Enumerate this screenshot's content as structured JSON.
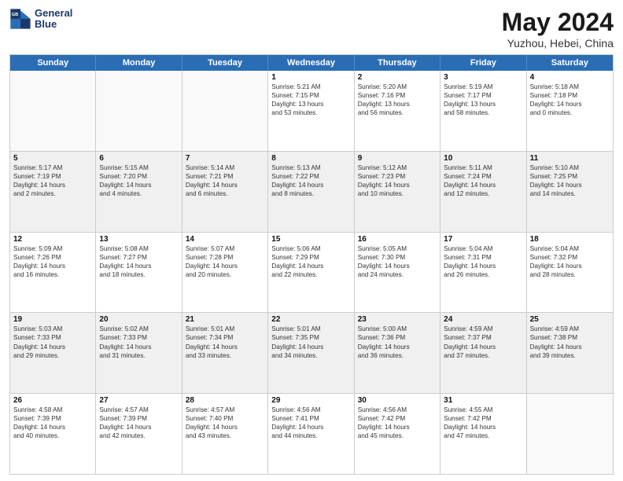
{
  "header": {
    "logo_line1": "General",
    "logo_line2": "Blue",
    "title": "May 2024",
    "location": "Yuzhou, Hebei, China"
  },
  "weekdays": [
    "Sunday",
    "Monday",
    "Tuesday",
    "Wednesday",
    "Thursday",
    "Friday",
    "Saturday"
  ],
  "rows": [
    [
      {
        "day": "",
        "info": [],
        "empty": true
      },
      {
        "day": "",
        "info": [],
        "empty": true
      },
      {
        "day": "",
        "info": [],
        "empty": true
      },
      {
        "day": "1",
        "info": [
          "Sunrise: 5:21 AM",
          "Sunset: 7:15 PM",
          "Daylight: 13 hours",
          "and 53 minutes."
        ]
      },
      {
        "day": "2",
        "info": [
          "Sunrise: 5:20 AM",
          "Sunset: 7:16 PM",
          "Daylight: 13 hours",
          "and 56 minutes."
        ]
      },
      {
        "day": "3",
        "info": [
          "Sunrise: 5:19 AM",
          "Sunset: 7:17 PM",
          "Daylight: 13 hours",
          "and 58 minutes."
        ]
      },
      {
        "day": "4",
        "info": [
          "Sunrise: 5:18 AM",
          "Sunset: 7:18 PM",
          "Daylight: 14 hours",
          "and 0 minutes."
        ]
      }
    ],
    [
      {
        "day": "5",
        "info": [
          "Sunrise: 5:17 AM",
          "Sunset: 7:19 PM",
          "Daylight: 14 hours",
          "and 2 minutes."
        ],
        "shaded": true
      },
      {
        "day": "6",
        "info": [
          "Sunrise: 5:15 AM",
          "Sunset: 7:20 PM",
          "Daylight: 14 hours",
          "and 4 minutes."
        ],
        "shaded": true
      },
      {
        "day": "7",
        "info": [
          "Sunrise: 5:14 AM",
          "Sunset: 7:21 PM",
          "Daylight: 14 hours",
          "and 6 minutes."
        ],
        "shaded": true
      },
      {
        "day": "8",
        "info": [
          "Sunrise: 5:13 AM",
          "Sunset: 7:22 PM",
          "Daylight: 14 hours",
          "and 8 minutes."
        ],
        "shaded": true
      },
      {
        "day": "9",
        "info": [
          "Sunrise: 5:12 AM",
          "Sunset: 7:23 PM",
          "Daylight: 14 hours",
          "and 10 minutes."
        ],
        "shaded": true
      },
      {
        "day": "10",
        "info": [
          "Sunrise: 5:11 AM",
          "Sunset: 7:24 PM",
          "Daylight: 14 hours",
          "and 12 minutes."
        ],
        "shaded": true
      },
      {
        "day": "11",
        "info": [
          "Sunrise: 5:10 AM",
          "Sunset: 7:25 PM",
          "Daylight: 14 hours",
          "and 14 minutes."
        ],
        "shaded": true
      }
    ],
    [
      {
        "day": "12",
        "info": [
          "Sunrise: 5:09 AM",
          "Sunset: 7:26 PM",
          "Daylight: 14 hours",
          "and 16 minutes."
        ]
      },
      {
        "day": "13",
        "info": [
          "Sunrise: 5:08 AM",
          "Sunset: 7:27 PM",
          "Daylight: 14 hours",
          "and 18 minutes."
        ]
      },
      {
        "day": "14",
        "info": [
          "Sunrise: 5:07 AM",
          "Sunset: 7:28 PM",
          "Daylight: 14 hours",
          "and 20 minutes."
        ]
      },
      {
        "day": "15",
        "info": [
          "Sunrise: 5:06 AM",
          "Sunset: 7:29 PM",
          "Daylight: 14 hours",
          "and 22 minutes."
        ]
      },
      {
        "day": "16",
        "info": [
          "Sunrise: 5:05 AM",
          "Sunset: 7:30 PM",
          "Daylight: 14 hours",
          "and 24 minutes."
        ]
      },
      {
        "day": "17",
        "info": [
          "Sunrise: 5:04 AM",
          "Sunset: 7:31 PM",
          "Daylight: 14 hours",
          "and 26 minutes."
        ]
      },
      {
        "day": "18",
        "info": [
          "Sunrise: 5:04 AM",
          "Sunset: 7:32 PM",
          "Daylight: 14 hours",
          "and 28 minutes."
        ]
      }
    ],
    [
      {
        "day": "19",
        "info": [
          "Sunrise: 5:03 AM",
          "Sunset: 7:33 PM",
          "Daylight: 14 hours",
          "and 29 minutes."
        ],
        "shaded": true
      },
      {
        "day": "20",
        "info": [
          "Sunrise: 5:02 AM",
          "Sunset: 7:33 PM",
          "Daylight: 14 hours",
          "and 31 minutes."
        ],
        "shaded": true
      },
      {
        "day": "21",
        "info": [
          "Sunrise: 5:01 AM",
          "Sunset: 7:34 PM",
          "Daylight: 14 hours",
          "and 33 minutes."
        ],
        "shaded": true
      },
      {
        "day": "22",
        "info": [
          "Sunrise: 5:01 AM",
          "Sunset: 7:35 PM",
          "Daylight: 14 hours",
          "and 34 minutes."
        ],
        "shaded": true
      },
      {
        "day": "23",
        "info": [
          "Sunrise: 5:00 AM",
          "Sunset: 7:36 PM",
          "Daylight: 14 hours",
          "and 36 minutes."
        ],
        "shaded": true
      },
      {
        "day": "24",
        "info": [
          "Sunrise: 4:59 AM",
          "Sunset: 7:37 PM",
          "Daylight: 14 hours",
          "and 37 minutes."
        ],
        "shaded": true
      },
      {
        "day": "25",
        "info": [
          "Sunrise: 4:59 AM",
          "Sunset: 7:38 PM",
          "Daylight: 14 hours",
          "and 39 minutes."
        ],
        "shaded": true
      }
    ],
    [
      {
        "day": "26",
        "info": [
          "Sunrise: 4:58 AM",
          "Sunset: 7:39 PM",
          "Daylight: 14 hours",
          "and 40 minutes."
        ]
      },
      {
        "day": "27",
        "info": [
          "Sunrise: 4:57 AM",
          "Sunset: 7:39 PM",
          "Daylight: 14 hours",
          "and 42 minutes."
        ]
      },
      {
        "day": "28",
        "info": [
          "Sunrise: 4:57 AM",
          "Sunset: 7:40 PM",
          "Daylight: 14 hours",
          "and 43 minutes."
        ]
      },
      {
        "day": "29",
        "info": [
          "Sunrise: 4:56 AM",
          "Sunset: 7:41 PM",
          "Daylight: 14 hours",
          "and 44 minutes."
        ]
      },
      {
        "day": "30",
        "info": [
          "Sunrise: 4:56 AM",
          "Sunset: 7:42 PM",
          "Daylight: 14 hours",
          "and 45 minutes."
        ]
      },
      {
        "day": "31",
        "info": [
          "Sunrise: 4:55 AM",
          "Sunset: 7:42 PM",
          "Daylight: 14 hours",
          "and 47 minutes."
        ]
      },
      {
        "day": "",
        "info": [],
        "empty": true
      }
    ]
  ]
}
